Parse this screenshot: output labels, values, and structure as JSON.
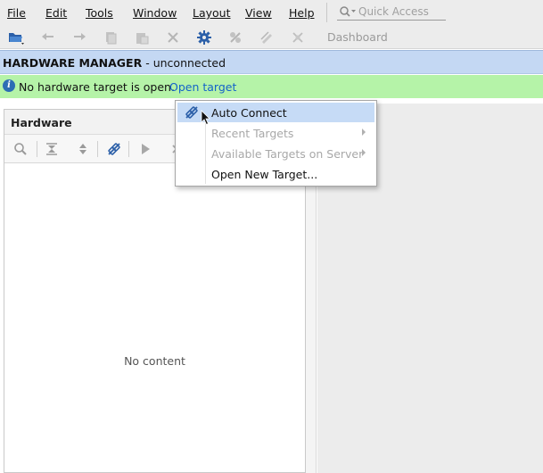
{
  "menubar": {
    "items": [
      {
        "label": "File",
        "mnemonic": "F"
      },
      {
        "label": "Edit",
        "mnemonic": "E"
      },
      {
        "label": "Tools",
        "mnemonic": "T"
      },
      {
        "label": "Window",
        "mnemonic": "W"
      },
      {
        "label": "Layout",
        "mnemonic": "y"
      },
      {
        "label": "View",
        "mnemonic": "V"
      },
      {
        "label": "Help",
        "mnemonic": "H"
      }
    ],
    "quick_access_placeholder": "Quick Access"
  },
  "toolbar": {
    "icons": [
      "open-project-icon",
      "undo-icon",
      "redo-icon",
      "copy-icon",
      "paste-icon",
      "delete-icon",
      "settings-icon",
      "autoconnect-disabled-icon",
      "program-device-icon",
      "disconnect-icon"
    ],
    "dashboard_label": "Dashboard"
  },
  "hardware_manager": {
    "title": "HARDWARE MANAGER",
    "separator": " - ",
    "status": "unconnected"
  },
  "info_bar": {
    "message": "No hardware target is open.",
    "link": "Open target"
  },
  "hardware_panel": {
    "title": "Hardware",
    "toolbar_icons": [
      "search-icon",
      "collapse-all-icon",
      "expand-all-icon",
      "auto-connect-icon",
      "run-icon",
      "close-icon"
    ],
    "empty_text": "No content"
  },
  "dropdown": {
    "items": [
      {
        "label": "Auto Connect",
        "enabled": true,
        "submenu": false,
        "highlighted": true
      },
      {
        "label": "Recent Targets",
        "enabled": false,
        "submenu": true,
        "highlighted": false
      },
      {
        "label": "Available Targets on Server",
        "enabled": false,
        "submenu": true,
        "highlighted": false
      },
      {
        "label": "Open New Target...",
        "enabled": true,
        "submenu": false,
        "highlighted": false
      }
    ]
  },
  "colors": {
    "title_bar": "#c4d8f3",
    "info_bar": "#b5f3a8",
    "link": "#1463c9",
    "menu_highlight": "#c6dbf6",
    "toolbar_icon_blue": "#2b5fa8"
  }
}
